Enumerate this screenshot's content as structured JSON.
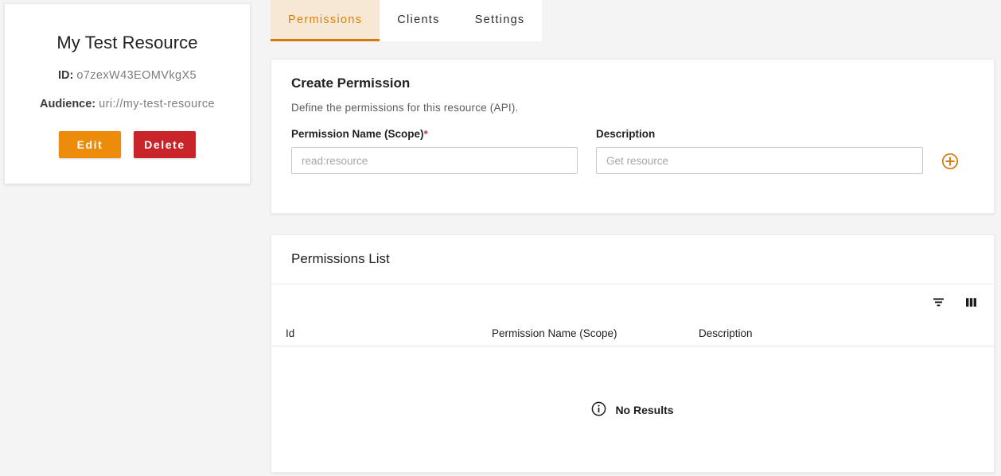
{
  "resource": {
    "title": "My Test Resource",
    "id_label": "ID:",
    "id_value": "o7zexW43EOMVkgX5",
    "audience_label": "Audience:",
    "audience_value": "uri://my-test-resource",
    "edit_label": "Edit",
    "delete_label": "Delete"
  },
  "tabs": [
    {
      "label": "Permissions",
      "active": true
    },
    {
      "label": "Clients",
      "active": false
    },
    {
      "label": "Settings",
      "active": false
    }
  ],
  "create_permission": {
    "title": "Create Permission",
    "subtitle": "Define the permissions for this resource (API).",
    "scope_label": "Permission Name (Scope)",
    "scope_required_mark": "*",
    "scope_value": "",
    "scope_placeholder": "read:resource",
    "description_label": "Description",
    "description_value": "",
    "description_placeholder": "Get resource",
    "add_icon": "plus-circle-icon"
  },
  "permissions_list": {
    "title": "Permissions List",
    "toolbar": {
      "filter_icon": "filter-icon",
      "columns_icon": "columns-icon"
    },
    "columns": [
      "Id",
      "Permission Name (Scope)",
      "Description"
    ],
    "rows": [],
    "empty_state": {
      "icon": "info-circle-icon",
      "text": "No Results"
    }
  },
  "colors": {
    "accent_orange": "#d4780f",
    "edit_orange": "#ed8b0a",
    "delete_red": "#c8242a",
    "tab_active_bg": "#f7e7d5",
    "page_bg": "#f4f4f4",
    "required_red": "#b3373d"
  }
}
